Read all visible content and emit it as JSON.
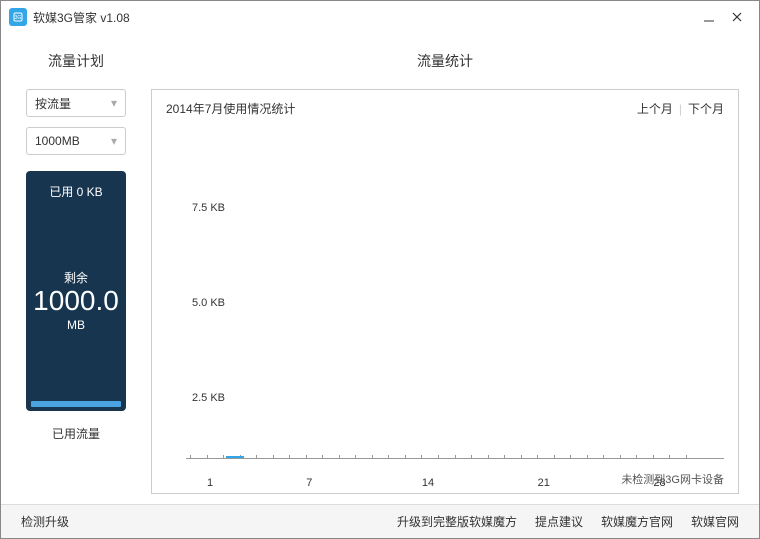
{
  "window": {
    "title": "软媒3G管家 v1.08"
  },
  "left": {
    "section_title": "流量计划",
    "select_mode": "按流量",
    "select_quota": "1000MB",
    "used_label": "已用 0 KB",
    "remain_label": "剩余",
    "remain_value": "1000.0",
    "remain_unit": "MB",
    "gauge_caption": "已用流量"
  },
  "right": {
    "section_title": "流量统计",
    "chart_title": "2014年7月使用情况统计",
    "prev": "上个月",
    "next": "下个月",
    "status": "未检测到3G网卡设备"
  },
  "footer": {
    "check_update": "检测升级",
    "upgrade_full": "升级到完整版软媒魔方",
    "feedback": "提点建议",
    "mofang_site": "软媒魔方官网",
    "ruanmei_site": "软媒官网"
  },
  "chart_data": {
    "type": "bar",
    "title": "2014年7月使用情况统计",
    "ylabel": "KB",
    "y_ticks": [
      "7.5 KB",
      "5.0 KB",
      "2.5 KB"
    ],
    "x_ticks": [
      1,
      7,
      14,
      21,
      28
    ],
    "x_range": [
      1,
      31
    ],
    "ylim": [
      0,
      10
    ],
    "values": []
  }
}
